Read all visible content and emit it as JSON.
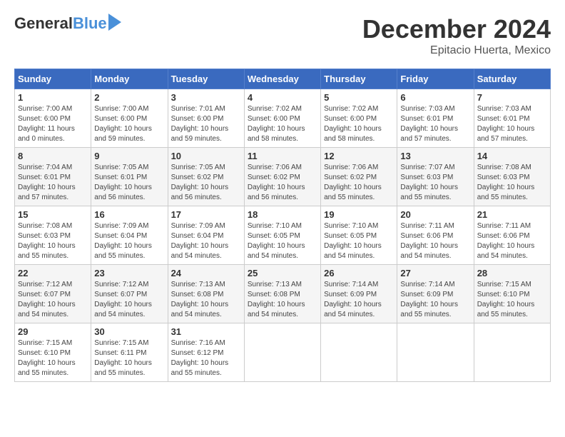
{
  "header": {
    "logo": {
      "general": "General",
      "blue": "Blue"
    },
    "title": "December 2024",
    "location": "Epitacio Huerta, Mexico"
  },
  "calendar": {
    "days_of_week": [
      "Sunday",
      "Monday",
      "Tuesday",
      "Wednesday",
      "Thursday",
      "Friday",
      "Saturday"
    ],
    "weeks": [
      [
        {
          "day": "1",
          "info": "Sunrise: 7:00 AM\nSunset: 6:00 PM\nDaylight: 11 hours\nand 0 minutes."
        },
        {
          "day": "2",
          "info": "Sunrise: 7:00 AM\nSunset: 6:00 PM\nDaylight: 10 hours\nand 59 minutes."
        },
        {
          "day": "3",
          "info": "Sunrise: 7:01 AM\nSunset: 6:00 PM\nDaylight: 10 hours\nand 59 minutes."
        },
        {
          "day": "4",
          "info": "Sunrise: 7:02 AM\nSunset: 6:00 PM\nDaylight: 10 hours\nand 58 minutes."
        },
        {
          "day": "5",
          "info": "Sunrise: 7:02 AM\nSunset: 6:00 PM\nDaylight: 10 hours\nand 58 minutes."
        },
        {
          "day": "6",
          "info": "Sunrise: 7:03 AM\nSunset: 6:01 PM\nDaylight: 10 hours\nand 57 minutes."
        },
        {
          "day": "7",
          "info": "Sunrise: 7:03 AM\nSunset: 6:01 PM\nDaylight: 10 hours\nand 57 minutes."
        }
      ],
      [
        {
          "day": "8",
          "info": "Sunrise: 7:04 AM\nSunset: 6:01 PM\nDaylight: 10 hours\nand 57 minutes."
        },
        {
          "day": "9",
          "info": "Sunrise: 7:05 AM\nSunset: 6:01 PM\nDaylight: 10 hours\nand 56 minutes."
        },
        {
          "day": "10",
          "info": "Sunrise: 7:05 AM\nSunset: 6:02 PM\nDaylight: 10 hours\nand 56 minutes."
        },
        {
          "day": "11",
          "info": "Sunrise: 7:06 AM\nSunset: 6:02 PM\nDaylight: 10 hours\nand 56 minutes."
        },
        {
          "day": "12",
          "info": "Sunrise: 7:06 AM\nSunset: 6:02 PM\nDaylight: 10 hours\nand 55 minutes."
        },
        {
          "day": "13",
          "info": "Sunrise: 7:07 AM\nSunset: 6:03 PM\nDaylight: 10 hours\nand 55 minutes."
        },
        {
          "day": "14",
          "info": "Sunrise: 7:08 AM\nSunset: 6:03 PM\nDaylight: 10 hours\nand 55 minutes."
        }
      ],
      [
        {
          "day": "15",
          "info": "Sunrise: 7:08 AM\nSunset: 6:03 PM\nDaylight: 10 hours\nand 55 minutes."
        },
        {
          "day": "16",
          "info": "Sunrise: 7:09 AM\nSunset: 6:04 PM\nDaylight: 10 hours\nand 55 minutes."
        },
        {
          "day": "17",
          "info": "Sunrise: 7:09 AM\nSunset: 6:04 PM\nDaylight: 10 hours\nand 54 minutes."
        },
        {
          "day": "18",
          "info": "Sunrise: 7:10 AM\nSunset: 6:05 PM\nDaylight: 10 hours\nand 54 minutes."
        },
        {
          "day": "19",
          "info": "Sunrise: 7:10 AM\nSunset: 6:05 PM\nDaylight: 10 hours\nand 54 minutes."
        },
        {
          "day": "20",
          "info": "Sunrise: 7:11 AM\nSunset: 6:06 PM\nDaylight: 10 hours\nand 54 minutes."
        },
        {
          "day": "21",
          "info": "Sunrise: 7:11 AM\nSunset: 6:06 PM\nDaylight: 10 hours\nand 54 minutes."
        }
      ],
      [
        {
          "day": "22",
          "info": "Sunrise: 7:12 AM\nSunset: 6:07 PM\nDaylight: 10 hours\nand 54 minutes."
        },
        {
          "day": "23",
          "info": "Sunrise: 7:12 AM\nSunset: 6:07 PM\nDaylight: 10 hours\nand 54 minutes."
        },
        {
          "day": "24",
          "info": "Sunrise: 7:13 AM\nSunset: 6:08 PM\nDaylight: 10 hours\nand 54 minutes."
        },
        {
          "day": "25",
          "info": "Sunrise: 7:13 AM\nSunset: 6:08 PM\nDaylight: 10 hours\nand 54 minutes."
        },
        {
          "day": "26",
          "info": "Sunrise: 7:14 AM\nSunset: 6:09 PM\nDaylight: 10 hours\nand 54 minutes."
        },
        {
          "day": "27",
          "info": "Sunrise: 7:14 AM\nSunset: 6:09 PM\nDaylight: 10 hours\nand 55 minutes."
        },
        {
          "day": "28",
          "info": "Sunrise: 7:15 AM\nSunset: 6:10 PM\nDaylight: 10 hours\nand 55 minutes."
        }
      ],
      [
        {
          "day": "29",
          "info": "Sunrise: 7:15 AM\nSunset: 6:10 PM\nDaylight: 10 hours\nand 55 minutes."
        },
        {
          "day": "30",
          "info": "Sunrise: 7:15 AM\nSunset: 6:11 PM\nDaylight: 10 hours\nand 55 minutes."
        },
        {
          "day": "31",
          "info": "Sunrise: 7:16 AM\nSunset: 6:12 PM\nDaylight: 10 hours\nand 55 minutes."
        },
        {
          "day": "",
          "info": ""
        },
        {
          "day": "",
          "info": ""
        },
        {
          "day": "",
          "info": ""
        },
        {
          "day": "",
          "info": ""
        }
      ]
    ]
  }
}
